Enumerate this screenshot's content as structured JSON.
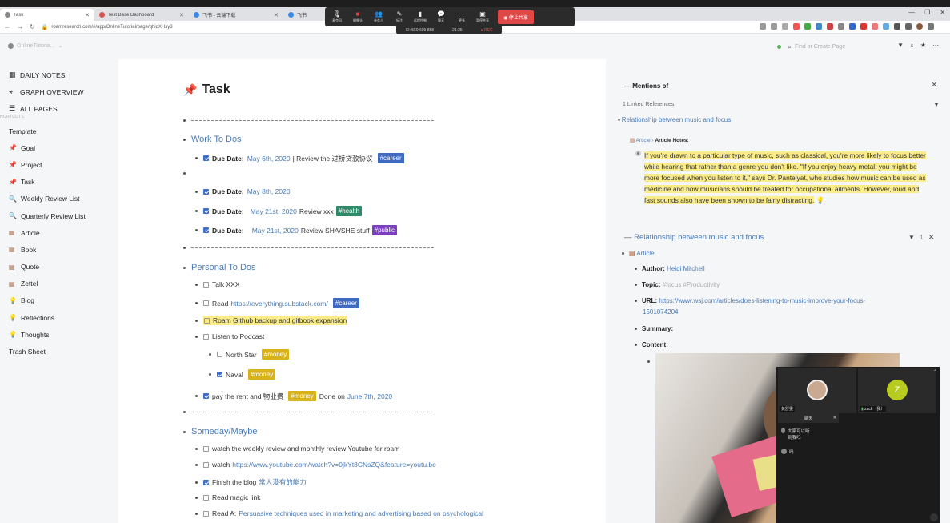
{
  "browser": {
    "tabs": [
      {
        "title": "Task",
        "close": "✕",
        "active": true
      },
      {
        "title": "Test Base Dashboard",
        "close": "✕",
        "active": false
      },
      {
        "title": "飞书 - 云端下载",
        "close": "✕",
        "active": false
      },
      {
        "title": "飞书",
        "close": "✕",
        "active": false
      }
    ],
    "new_tab": "+",
    "window_controls": [
      "—",
      "❐",
      "✕"
    ],
    "url": "roamresearch.com/#/app/OnlineTutorial/page/qhiqXHsy3"
  },
  "meeting": {
    "items": [
      {
        "glyph": "🎙",
        "label": "麦克风"
      },
      {
        "glyph": "■",
        "label": "摄像头"
      },
      {
        "glyph": "👥",
        "label": "参会人"
      },
      {
        "glyph": "✎",
        "label": "标注"
      },
      {
        "glyph": "▮",
        "label": "远程控制"
      },
      {
        "glyph": "💬",
        "label": "聊天"
      },
      {
        "glyph": "⋯",
        "label": "更多"
      },
      {
        "glyph": "▣",
        "label": "暂停共享"
      }
    ],
    "stop_share": "停止共享",
    "meeting_id": "ID: 559 609 858",
    "timer": "21:35",
    "rec": "● REC"
  },
  "roam_header": {
    "db_name": "OnlineTutoria...",
    "search_placeholder": "Find or Create Page"
  },
  "sidebar": {
    "main_items": [
      {
        "glyph": "▦",
        "label": "DAILY NOTES"
      },
      {
        "glyph": "⚹",
        "label": "GRAPH OVERVIEW"
      },
      {
        "glyph": "☰",
        "label": "ALL PAGES"
      }
    ],
    "shortcuts_label": "HORTCUTS",
    "shortcuts": [
      {
        "glyph": "",
        "label": "Template"
      },
      {
        "glyph": "📌",
        "label": "Goal"
      },
      {
        "glyph": "📌",
        "label": "Project"
      },
      {
        "glyph": "📌",
        "label": "Task"
      },
      {
        "glyph": "🔍",
        "label": "Weekly Review List"
      },
      {
        "glyph": "🔍",
        "label": "Quarterly Review List"
      },
      {
        "glyph": "▤",
        "label": "Article"
      },
      {
        "glyph": "▤",
        "label": "Book"
      },
      {
        "glyph": "▤",
        "label": "Quote"
      },
      {
        "glyph": "▤",
        "label": "Zettel"
      },
      {
        "glyph": "💡",
        "label": "Blog"
      },
      {
        "glyph": "💡",
        "label": "Reflections"
      },
      {
        "glyph": "💡",
        "label": "Thoughts"
      },
      {
        "glyph": "",
        "label": "Trash Sheet"
      }
    ]
  },
  "page": {
    "title": "Task",
    "work_heading": "Work To Dos",
    "due_label": "Due Date:",
    "work_items": [
      {
        "date": "May 6th, 2020",
        "text": "| Review the 过桥贷款协议",
        "tag": "#career"
      },
      {
        "date": "May 8th, 2020",
        "text": "",
        "tag": ""
      },
      {
        "date": "May 21st, 2020",
        "text": "Review xxx",
        "tag": "#health"
      },
      {
        "date": "May 21st, 2020",
        "text": "Review SHA/SHE stuff",
        "tag": "#public"
      }
    ],
    "personal_heading": "Personal To Dos",
    "personal": {
      "talk": "Talk XXX",
      "read_prefix": "Read",
      "read_link": "https://everything.substack.com/",
      "read_tag": "#career",
      "roam": "Roam Github backup  and gitbook expansion",
      "podcast": "Listen to Podcast",
      "north_star": "North Star",
      "naval": "Naval",
      "money_tag": "#money",
      "rent": "pay the rent and 物业费",
      "rent_done": "Done on",
      "rent_date": "June 7th, 2020"
    },
    "someday_heading": "Someday/Maybe",
    "someday": {
      "weekly": "watch the weekly review and monthly review Youtube for roam",
      "watch_prefix": "watch",
      "watch_link": "https://www.youtube.com/watch?v=0jkYt8CNsZQ&feature=youtu.be",
      "blog_prefix": "Finish the blog",
      "blog_link": "常人没有的能力",
      "magic": "Read magic link",
      "read_a_prefix": "Read A:",
      "read_a_link": "Persuasive techniques used in marketing and advertising based on psychological"
    }
  },
  "right_panel": {
    "mentions_title": "Mentions of",
    "linked_refs": "1 Linked References",
    "ref_title": "Relationship between music and focus",
    "breadcrumb_article": "Article",
    "breadcrumb_sep": "›",
    "breadcrumb_notes": "Article Notes:",
    "quote": "If you're drawn to a particular type of music, such as classical, you're more likely to focus better while hearing that rather than a genre you don't like. \"If you enjoy heavy metal, you might be more focused when you listen to it,\" says Dr. Pantelyat, who studies how music can be used as medicine and how musicians should be treated for occupational ailments. However, loud and fast sounds also have been shown to be fairly distracting.",
    "quote_icon": "💡",
    "page_title": "Relationship between music and focus",
    "filter_count": "1",
    "article_label": "Article",
    "author_label": "Author:",
    "author_value": "Heidi Mitchell",
    "topic_label": "Topic:",
    "topic_value": "#focus  #Productivity",
    "url_label": "URL:",
    "url_value_1": "https://www.wsj.com/articles/does-listening-to-music-improve-your-focus-",
    "url_value_2": "1501074204",
    "summary_label": "Summary:",
    "content_label": "Content:"
  },
  "video": {
    "tile1_name": "黄舒雯",
    "tile2_name": "zack（我）",
    "tile2_initial": "Z",
    "chat_title": "聊天",
    "chat_close": "✕",
    "messages": [
      "大家可以听到我吗",
      "吗"
    ]
  },
  "colors": {
    "accent": "#4a7bb7",
    "career": "#3f6ac0",
    "health": "#2f8a6a",
    "public": "#7b3fc0",
    "money": "#d7b21a",
    "highlight": "#fbec8a",
    "stop_share": "#e04747"
  }
}
